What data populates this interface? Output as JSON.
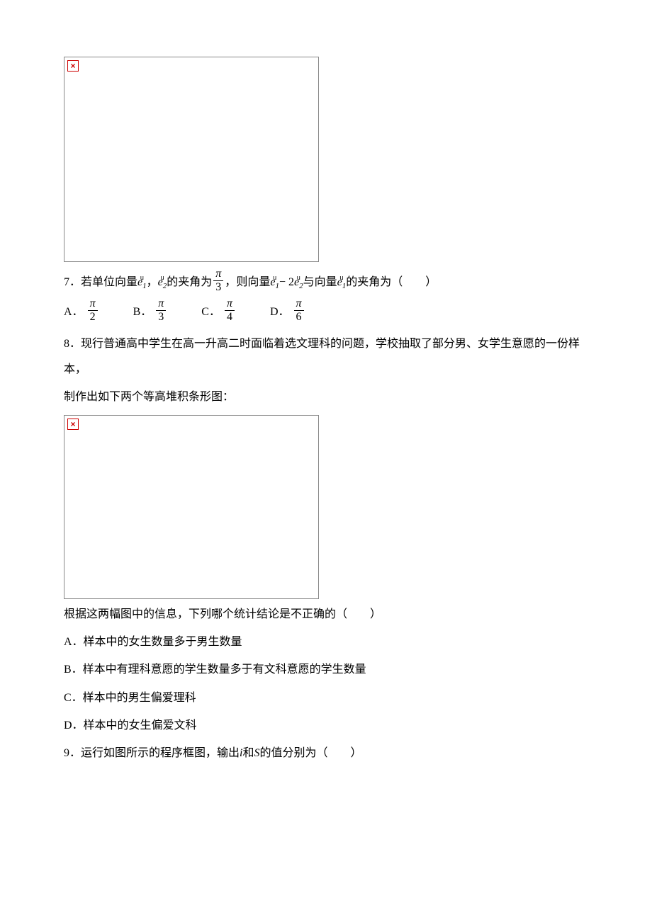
{
  "q7": {
    "number": "7．",
    "text_part1": "若单位向量",
    "e1_arrow": "u",
    "e1_base": "e",
    "e1_sub": "1",
    "comma1": "，",
    "e2_arrow": "u",
    "e2_base": "e",
    "e2_sub": "2",
    "text_part2": "的夹角为",
    "frac1_num": "π",
    "frac1_den": "3",
    "comma2": "，",
    "text_part3": "则向量",
    "e1b_arrow": "u",
    "e1b_base": "e",
    "e1b_sub": "1",
    "minus": " − 2",
    "e2b_arrow": "u",
    "e2b_base": "e",
    "e2b_sub": "2",
    "text_part4": "与向量",
    "e1c_arrow": "u",
    "e1c_base": "e",
    "e1c_sub": "1",
    "text_part5": "的夹角为（　　）",
    "optA_label": "A．",
    "optA_num": "π",
    "optA_den": "2",
    "optB_label": "B．",
    "optB_num": "π",
    "optB_den": "3",
    "optC_label": "C．",
    "optC_num": "π",
    "optC_den": "4",
    "optD_label": "D．",
    "optD_num": "π",
    "optD_den": "6"
  },
  "q8": {
    "number": "8．",
    "text1": "现行普通高中学生在高一升高二时面临着选文理科的问题，学校抽取了部分男、女学生意愿的一份样本，",
    "text2": "制作出如下两个等高堆积条形图：",
    "text3": "根据这两幅图中的信息，下列哪个统计结论是不正确的（　　）",
    "optA": "A．样本中的女生数量多于男生数量",
    "optB": "B．样本中有理科意愿的学生数量多于有文科意愿的学生数量",
    "optC": "C．样本中的男生偏爱理科",
    "optD": "D．样本中的女生偏爱文科"
  },
  "q9": {
    "number": "9．",
    "text_part1": "运行如图所示的程序框图，输出",
    "var_i": "i",
    "text_part2": "和",
    "var_s": "S",
    "text_part3": "的值分别为（　　）"
  },
  "icons": {
    "broken": "×"
  }
}
